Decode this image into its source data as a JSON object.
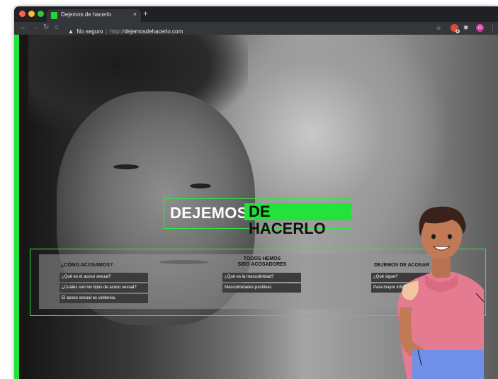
{
  "browser": {
    "tab_title": "Dejemos de hacerlo",
    "tab_close": "×",
    "new_tab": "+",
    "security_label": "No seguro",
    "url_protocol": "http://",
    "url_host": "dejemosdehacerlo.com",
    "extension_badge": "2",
    "profile_initial": "O",
    "colors": {
      "close": "#ff5f57",
      "minimize": "#febc2e",
      "maximize": "#28c840"
    }
  },
  "hero": {
    "title_white": "DEJEMOS",
    "title_green": "DE HACERLO",
    "accent": "#22e33a"
  },
  "nav": {
    "columns": [
      {
        "heading": "¿CÓMO ACOSAMOS?",
        "links": [
          "¿Qué es el acoso sexual?",
          "¿Cuáles son los tipos de acoso sexual?",
          "El acoso sexual es violencia"
        ]
      },
      {
        "heading_line1": "TODOS HEMOS",
        "heading_line2": "SIDO ACOSADORES",
        "links": [
          "¿Qué es la masculinidad?",
          "Masculinidades positivas"
        ]
      },
      {
        "heading": "DEJEMOS DE ACOSAR",
        "links": [
          "¿Qué sigue?",
          "Para mayor información"
        ]
      }
    ]
  }
}
